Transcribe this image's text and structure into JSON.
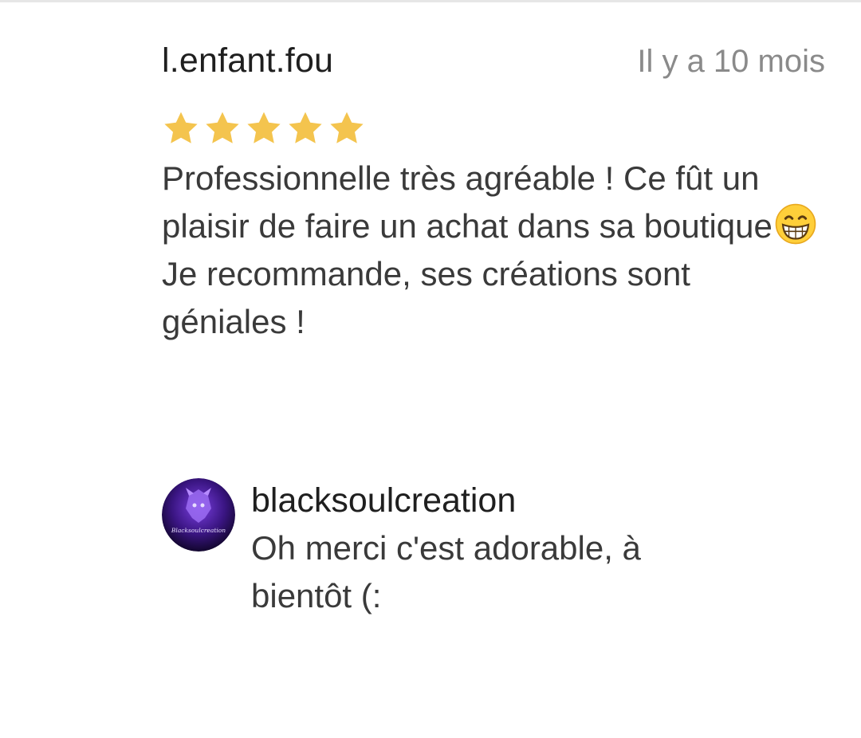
{
  "review": {
    "author": "l.enfant.fou",
    "date": "Il y a 10 mois",
    "rating": 5,
    "rating_max": 5,
    "star_color": "#f4c44e",
    "text_line_1": "Professionnelle très agréable ! Ce fût un plaisir de faire un achat dans sa boutique",
    "emoji": "grinning-face-icon",
    "text_line_2": "Je recommande, ses créations sont géniales !"
  },
  "reply": {
    "author": "blacksoulcreation",
    "avatar_text": "Blacksoulcreation",
    "text": "Oh merci c'est adorable, à bientôt (:",
    "accent_color": "#5b2fb8"
  }
}
